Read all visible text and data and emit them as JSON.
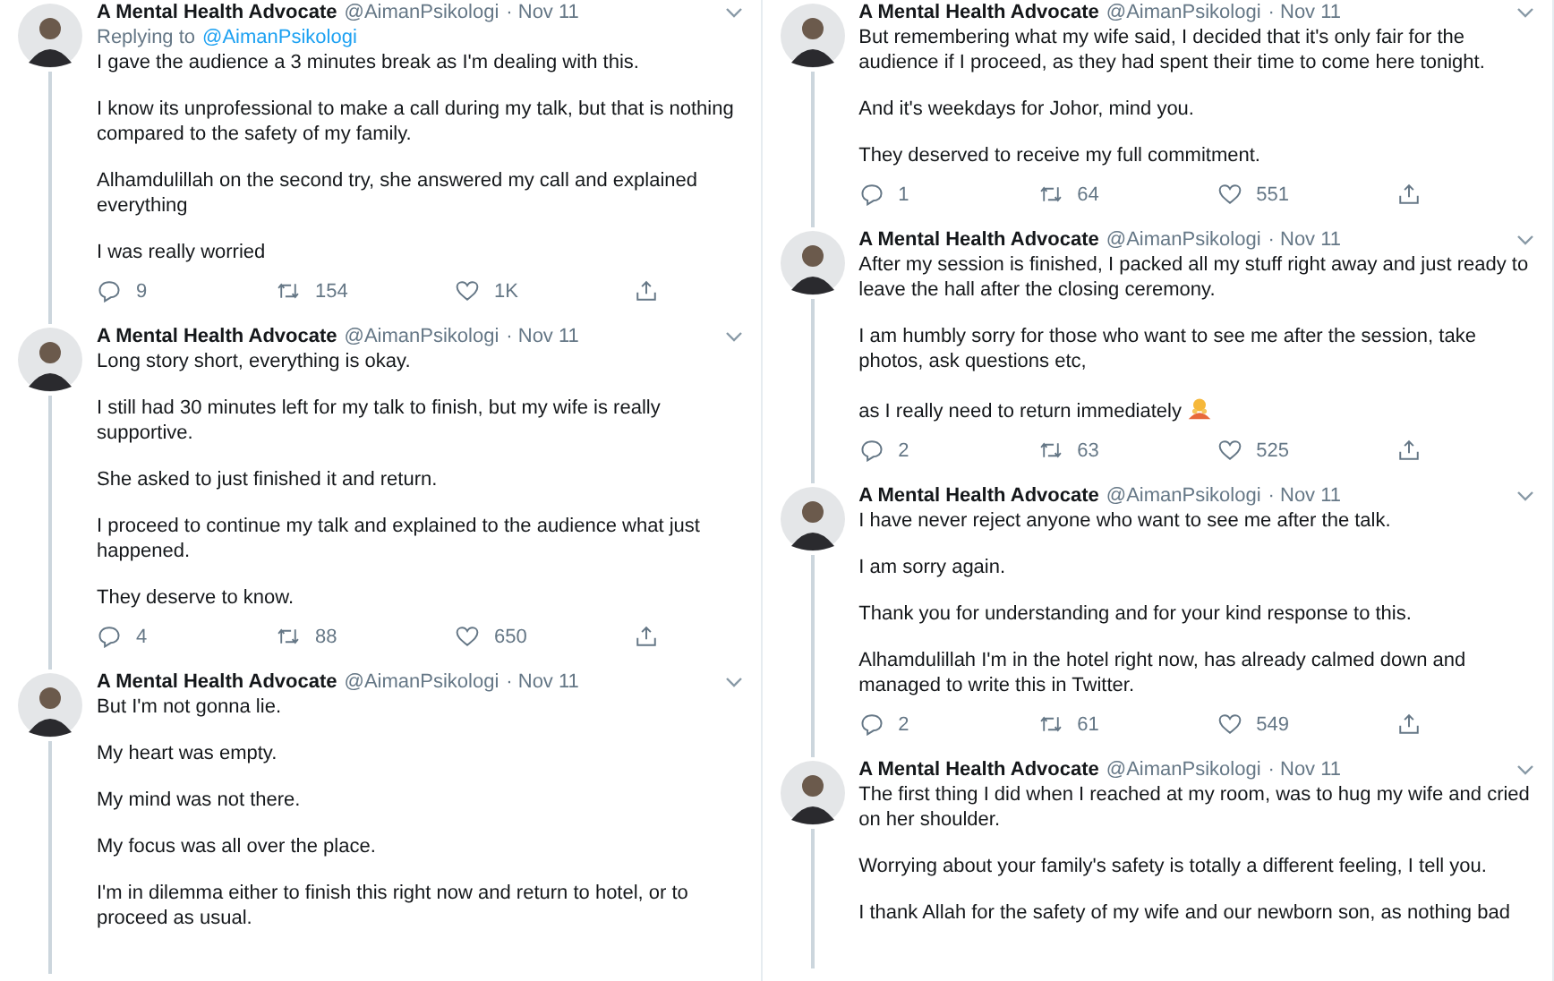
{
  "columns": [
    {
      "tweets": [
        {
          "name": "A Mental Health Advocate",
          "handle": "@AimanPsikologi",
          "date": "· Nov 11",
          "replying_to": {
            "label": "Replying to",
            "handle": "@AimanPsikologi"
          },
          "paragraphs": [
            "I gave the audience a 3 minutes break as I'm dealing with this.",
            "I know its unprofessional to make a call during my talk, but that is nothing compared to the safety of my family.",
            "Alhamdulillah on the second try, she answered my call and explained everything",
            "I was really worried"
          ],
          "actions": {
            "replies": "9",
            "retweets": "154",
            "likes": "1K"
          }
        },
        {
          "name": "A Mental Health Advocate",
          "handle": "@AimanPsikologi",
          "date": "· Nov 11",
          "paragraphs": [
            "Long story short, everything is okay.",
            "I still had 30 minutes left for my talk to finish, but my wife is really supportive.",
            "She asked to just finished it and return.",
            "I proceed to continue my talk and explained to the audience what just happened.",
            "They deserve to know."
          ],
          "actions": {
            "replies": "4",
            "retweets": "88",
            "likes": "650"
          }
        },
        {
          "name": "A Mental Health Advocate",
          "handle": "@AimanPsikologi",
          "date": "· Nov 11",
          "paragraphs": [
            "But I'm not gonna lie.",
            "My heart was empty.",
            "My mind was not there.",
            "My focus was all over the place.",
            "I'm in dilemma either to finish this right now and return to hotel, or to proceed as usual."
          ]
        }
      ]
    },
    {
      "tweets": [
        {
          "name": "A Mental Health Advocate",
          "handle": "@AimanPsikologi",
          "date": "· Nov 11",
          "paragraphs": [
            "But remembering what my wife said, I decided that it's only fair for the audience if I proceed, as they had spent their time to come here tonight.",
            "And it's weekdays for Johor, mind you.",
            "They deserved to receive my full commitment."
          ],
          "actions": {
            "replies": "1",
            "retweets": "64",
            "likes": "551"
          }
        },
        {
          "name": "A Mental Health Advocate",
          "handle": "@AimanPsikologi",
          "date": "· Nov 11",
          "paragraphs": [
            "After my session is finished, I packed all my stuff right away and just ready to leave the hall after the closing ceremony.",
            "I am humbly sorry for those who want to see me after the session, take photos, ask questions etc,",
            "as I really need to return immediately"
          ],
          "ends_with_emoji": true,
          "actions": {
            "replies": "2",
            "retweets": "63",
            "likes": "525"
          }
        },
        {
          "name": "A Mental Health Advocate",
          "handle": "@AimanPsikologi",
          "date": "· Nov 11",
          "paragraphs": [
            "I have never reject anyone who want to see me after the talk.",
            "I am sorry again.",
            "Thank you for understanding and for your kind response to this.",
            "Alhamdulillah I'm in the hotel right now, has already calmed down and managed to write this in Twitter."
          ],
          "actions": {
            "replies": "2",
            "retweets": "61",
            "likes": "549"
          }
        },
        {
          "name": "A Mental Health Advocate",
          "handle": "@AimanPsikologi",
          "date": "· Nov 11",
          "paragraphs": [
            "The first thing I did when I reached at my room, was to hug my wife and cried on her shoulder.",
            "Worrying about your family's safety is totally a different feeling, I tell you.",
            "I thank Allah for the safety of my wife and our newborn son, as nothing bad"
          ]
        }
      ]
    }
  ]
}
